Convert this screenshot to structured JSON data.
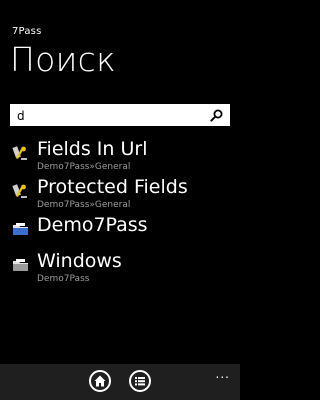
{
  "app": {
    "title": "7Pass"
  },
  "page": {
    "title": "Поиск"
  },
  "search": {
    "value": "d",
    "placeholder": ""
  },
  "results": [
    {
      "title": "Fields In Url",
      "subtitle": "Demo7Pass»General",
      "icon": "key-entry-icon"
    },
    {
      "title": "Protected Fields",
      "subtitle": "Demo7Pass»General",
      "icon": "key-entry-icon"
    },
    {
      "title": "Demo7Pass",
      "subtitle": "",
      "icon": "folder-icon"
    },
    {
      "title": "Windows",
      "subtitle": "Demo7Pass",
      "icon": "folder-icon"
    }
  ],
  "app_bar": {
    "buttons": [
      {
        "icon": "home-icon"
      },
      {
        "icon": "list-icon"
      }
    ],
    "more": "..."
  }
}
